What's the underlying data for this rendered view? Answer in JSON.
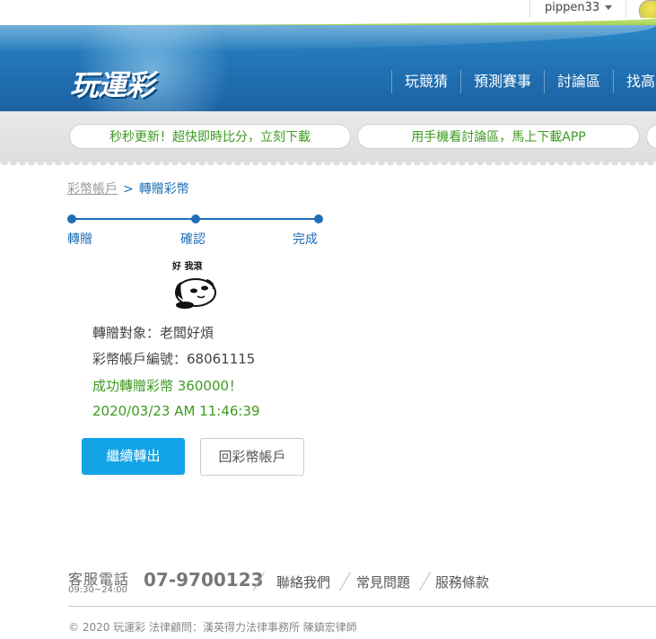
{
  "topbar": {
    "username": "pippen33"
  },
  "header": {
    "logo": "玩運彩",
    "nav": [
      "玩競猜",
      "預測賽事",
      "討論區",
      "找高"
    ]
  },
  "ads": [
    "秒秒更新！超快即時比分，立刻下載",
    "用手機看討論區，馬上下載APP"
  ],
  "breadcrumb": {
    "parent": "彩幣帳戶",
    "separator": ">",
    "current": "轉贈彩幣"
  },
  "steps": [
    "轉贈",
    "確認",
    "完成"
  ],
  "sticker": {
    "caption": "好 我滾"
  },
  "result": {
    "recipient": "轉贈對象：老闆好煩",
    "account_no": "彩幣帳戶編號：68061115",
    "success": "成功轉贈彩幣 360000！",
    "timestamp": "2020/03/23 AM 11:46:39"
  },
  "buttons": {
    "continue": "繼續轉出",
    "back": "回彩幣帳戶"
  },
  "footer": {
    "cs_title": "客服電話",
    "cs_hours": "09:30~24:00",
    "phone": "07-9700123",
    "links": [
      "聯絡我們",
      "常見問題",
      "服務條款"
    ],
    "copyright": "© 2020 玩運彩 法律顧問：漢英得力法律事務所 陳鎮宏律師"
  },
  "colors": {
    "brand_blue": "#1f6eb0",
    "accent_green": "#3d9a20",
    "button_blue": "#12a3e6"
  }
}
